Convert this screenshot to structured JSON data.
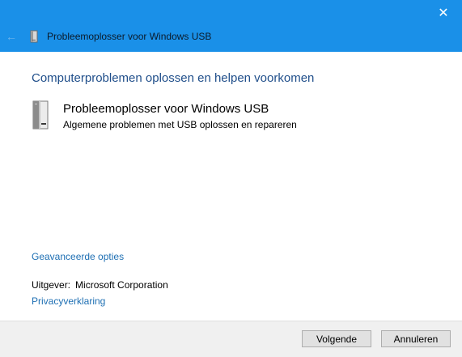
{
  "window": {
    "title": "Probleemoplosser voor Windows USB",
    "close_glyph": "✕",
    "back_glyph": "←"
  },
  "main": {
    "heading": "Computerproblemen oplossen en helpen voorkomen",
    "troubleshooter": {
      "title": "Probleemoplosser voor Windows USB",
      "description": "Algemene problemen met USB oplossen en repareren",
      "icon": "usb-drive-icon"
    },
    "advanced_link": "Geavanceerde opties",
    "publisher_label": "Uitgever:",
    "publisher_value": "Microsoft Corporation",
    "privacy_link": "Privacyverklaring"
  },
  "footer": {
    "next_label": "Volgende",
    "cancel_label": "Annuleren"
  },
  "colors": {
    "titlebar": "#1a90e8",
    "heading": "#1f4e8a",
    "link": "#1e6fb3"
  }
}
